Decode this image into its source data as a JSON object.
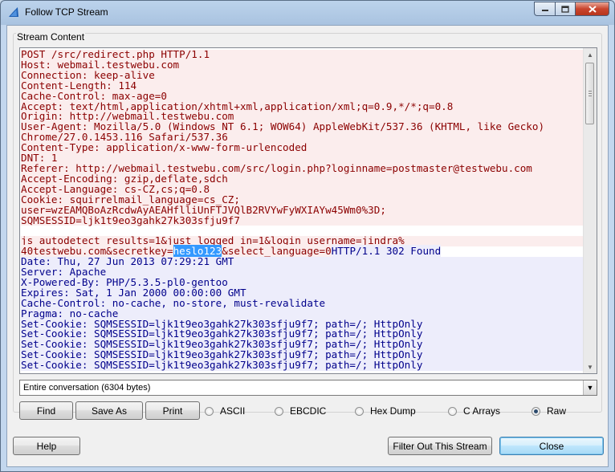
{
  "window": {
    "title": "Follow TCP Stream"
  },
  "group": {
    "label": "Stream Content"
  },
  "stream": {
    "client_lines": [
      "POST /src/redirect.php HTTP/1.1",
      "Host: webmail.testwebu.com",
      "Connection: keep-alive",
      "Content-Length: 114",
      "Cache-Control: max-age=0",
      "Accept: text/html,application/xhtml+xml,application/xml;q=0.9,*/*;q=0.8",
      "Origin: http://webmail.testwebu.com",
      "User-Agent: Mozilla/5.0 (Windows NT 6.1; WOW64) AppleWebKit/537.36 (KHTML, like Gecko)",
      "Chrome/27.0.1453.116 Safari/537.36",
      "Content-Type: application/x-www-form-urlencoded",
      "DNT: 1",
      "Referer: http://webmail.testwebu.com/src/login.php?loginname=postmaster@testwebu.com",
      "Accept-Encoding: gzip,deflate,sdch",
      "Accept-Language: cs-CZ,cs;q=0.8",
      "Cookie: squirrelmail_language=cs_CZ;",
      "user=wzEAMQBoAzRcdwAyAEAHflliUnFTJVQlB2RVYwFyWXIAYw45Wm0%3D;",
      "SQMSESSID=ljk1t9eo3gahk27k303sfju9f7"
    ],
    "body_line1": "js_autodetect_results=1&just_logged_in=1&login_username=jindra%",
    "body_line2_before": "40testwebu.com&secretkey=",
    "body_line2_selected": "heslo123",
    "body_line2_after": "&select_language=0",
    "response_status": "HTTP/1.1 302 Found",
    "server_lines": [
      "Date: Thu, 27 Jun 2013 07:29:21 GMT",
      "Server: Apache",
      "X-Powered-By: PHP/5.3.5-pl0-gentoo",
      "Expires: Sat, 1 Jan 2000 00:00:00 GMT",
      "Cache-Control: no-cache, no-store, must-revalidate",
      "Pragma: no-cache",
      "Set-Cookie: SQMSESSID=ljk1t9eo3gahk27k303sfju9f7; path=/; HttpOnly",
      "Set-Cookie: SQMSESSID=ljk1t9eo3gahk27k303sfju9f7; path=/; HttpOnly",
      "Set-Cookie: SQMSESSID=ljk1t9eo3gahk27k303sfju9f7; path=/; HttpOnly",
      "Set-Cookie: SQMSESSID=ljk1t9eo3gahk27k303sfju9f7; path=/; HttpOnly",
      "Set-Cookie: SQMSESSID=ljk1t9eo3gahk27k303sfju9f7; path=/; HttpOnly"
    ],
    "colors": {
      "client_text": "#8b0000",
      "client_bg": "#fbeded",
      "server_text": "#00008b",
      "server_bg": "#ededfb",
      "selection": "#3399ff"
    }
  },
  "conversation_select": {
    "value": "Entire conversation (6304 bytes)"
  },
  "buttons": {
    "find": "Find",
    "save_as": "Save As",
    "print": "Print",
    "help": "Help",
    "filter_out": "Filter Out This Stream",
    "close": "Close"
  },
  "format_options": [
    {
      "label": "ASCII",
      "selected": false
    },
    {
      "label": "EBCDIC",
      "selected": false
    },
    {
      "label": "Hex Dump",
      "selected": false
    },
    {
      "label": "C Arrays",
      "selected": false
    },
    {
      "label": "Raw",
      "selected": true
    }
  ]
}
